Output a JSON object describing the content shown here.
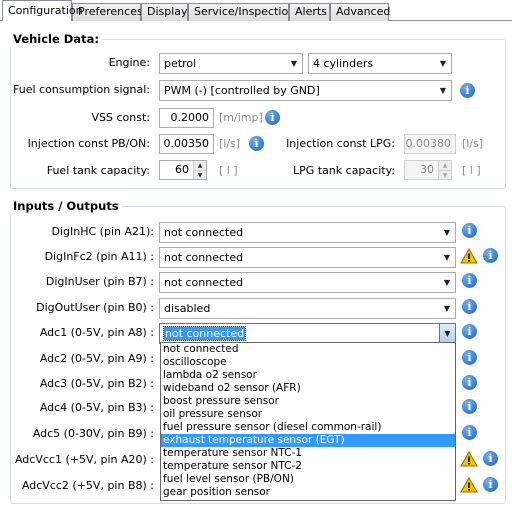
{
  "tabs": [
    "Configuration",
    "Preferences",
    "Display",
    "Service/Inspection",
    "Alerts",
    "Advanced"
  ],
  "vehicle": {
    "title": "Vehicle Data:",
    "engine_label": "Engine:",
    "engine_value": "petrol",
    "cylinders_value": "4 cylinders",
    "fuel_signal_label": "Fuel consumption signal:",
    "fuel_signal_value": "PWM (-)  [controlled by GND]",
    "vss_label": "VSS const:",
    "vss_value": "0.2000",
    "vss_unit": "[m/imp]",
    "inj_pb_label": "Injection const PB/ON:",
    "inj_pb_value": "0.00350",
    "inj_pb_unit": "[l/s]",
    "inj_lpg_label": "Injection const LPG:",
    "inj_lpg_value": "0.00380",
    "inj_lpg_unit": "[l/s]",
    "tank_label": "Fuel tank capacity:",
    "tank_value": "60",
    "tank_unit": "[ l ]",
    "lpg_tank_label": "LPG tank capacity:",
    "lpg_tank_value": "30",
    "lpg_tank_unit": "[ l ]"
  },
  "io": {
    "title": "Inputs / Outputs",
    "rows": [
      {
        "label": "DigInHC (pin A21):",
        "value": "not connected"
      },
      {
        "label": "DigInFc2 (pin A11) :",
        "value": "not connected"
      },
      {
        "label": "DigInUser (pin B7) :",
        "value": "not connected"
      },
      {
        "label": "DigOutUser (pin B0) :",
        "value": "disabled"
      },
      {
        "label": "Adc1 (0-5V, pin A8) :",
        "value": "not connected"
      },
      {
        "label": "Adc2 (0-5V, pin A9) :",
        "value": ""
      },
      {
        "label": "Adc3 (0-5V, pin B2) :",
        "value": ""
      },
      {
        "label": "Adc4 (0-5V, pin B3) :",
        "value": ""
      },
      {
        "label": "Adc5 (0-30V, pin B9) :",
        "value": ""
      },
      {
        "label": "AdcVcc1 (+5V, pin A20) :",
        "value": ""
      },
      {
        "label": "AdcVcc2 (+5V, pin B8) :",
        "value": ""
      }
    ]
  },
  "dropdown": {
    "items": [
      "not connected",
      "oscilloscope",
      "lambda o2 sensor",
      "wideband o2 sensor (AFR)",
      "boost pressure sensor",
      "oil pressure sensor",
      "fuel pressure sensor (diesel common-rail)",
      "exhaust temperature sensor (EGT)",
      "temperature sensor NTC-1",
      "temperature sensor NTC-2",
      "fuel level sensor (PB/ON)",
      "gear position sensor"
    ],
    "highlighted_index": 7
  },
  "icons": {
    "info": "i",
    "warning": "warning-triangle-icon",
    "arrow": "▼",
    "up": "▲",
    "down": "▼"
  },
  "colors": {
    "accent": "#3399ff",
    "info": "#1a62b8",
    "warning": "#f5c400"
  }
}
